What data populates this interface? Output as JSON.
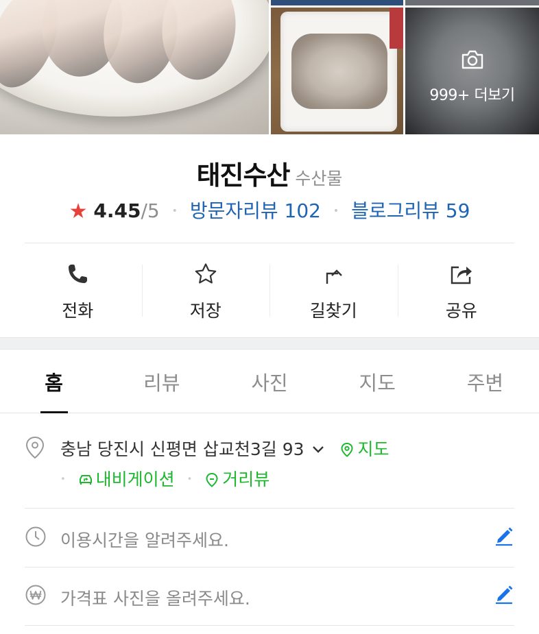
{
  "photos": {
    "more_label": "999+ 더보기"
  },
  "place": {
    "name": "태진수산",
    "category": "수산물",
    "rating": "4.45",
    "rating_max": "/5",
    "visitor_reviews": "방문자리뷰 102",
    "blog_reviews": "블로그리뷰 59",
    "rating_color": "#e8413b",
    "link_color": "#1d64b5"
  },
  "actions": [
    {
      "label": "전화",
      "icon": "phone-icon"
    },
    {
      "label": "저장",
      "icon": "star-outline-icon"
    },
    {
      "label": "길찾기",
      "icon": "directions-arrow-icon"
    },
    {
      "label": "공유",
      "icon": "share-icon"
    }
  ],
  "tabs": [
    {
      "label": "홈",
      "active": true
    },
    {
      "label": "리뷰",
      "active": false
    },
    {
      "label": "사진",
      "active": false
    },
    {
      "label": "지도",
      "active": false
    },
    {
      "label": "주변",
      "active": false
    }
  ],
  "address": {
    "text": "충남 당진시 신평면 삽교천3길 93",
    "map_link": "지도",
    "navigation_link": "내비게이션",
    "street_view_link": "거리뷰",
    "accent_color": "#1db82d"
  },
  "hours": {
    "placeholder": "이용시간을 알려주세요."
  },
  "price": {
    "placeholder": "가격표 사진을 올려주세요."
  },
  "edit_color": "#1a73e8"
}
